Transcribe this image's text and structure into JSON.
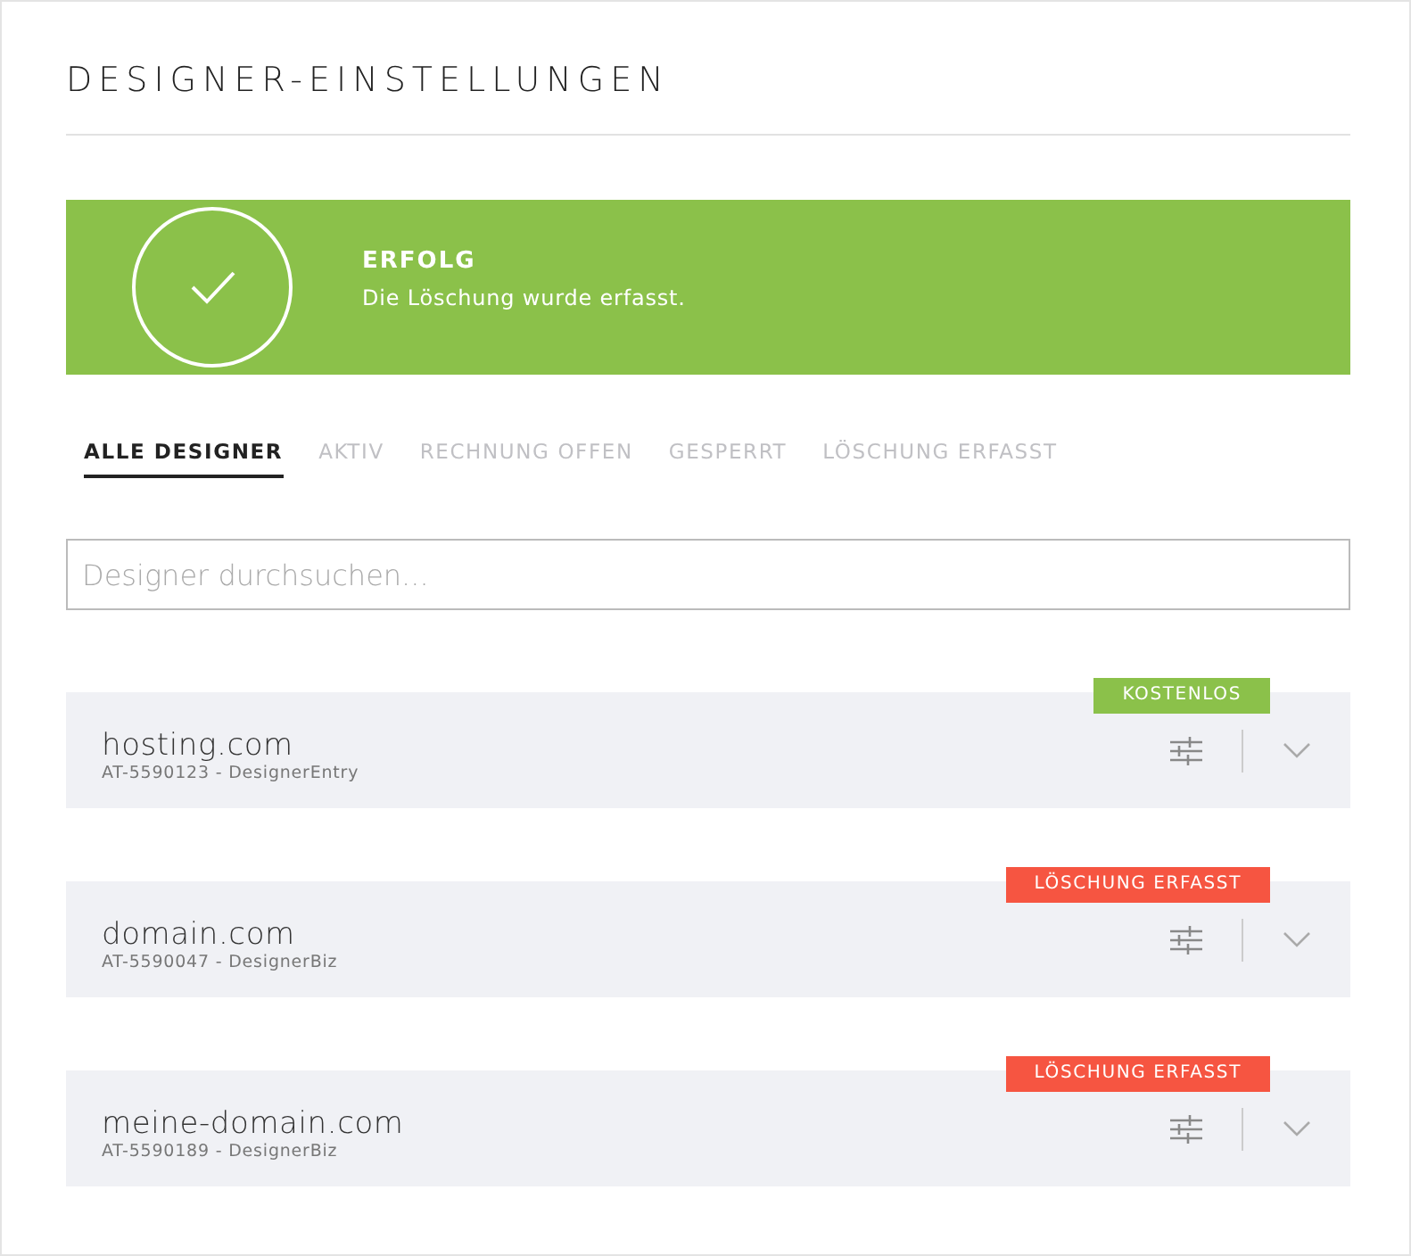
{
  "title": "DESIGNER-EINSTELLUNGEN",
  "alert": {
    "kind": "success",
    "heading": "ERFOLG",
    "message": "Die Löschung wurde erfasst."
  },
  "tabs": [
    {
      "label": "ALLE DESIGNER",
      "selected": true
    },
    {
      "label": "AKTIV",
      "selected": false
    },
    {
      "label": "RECHNUNG OFFEN",
      "selected": false
    },
    {
      "label": "GESPERRT",
      "selected": false
    },
    {
      "label": "LÖSCHUNG ERFASST",
      "selected": false
    }
  ],
  "search": {
    "placeholder": "Designer durchsuchen..."
  },
  "designers": [
    {
      "domain": "hosting.com",
      "details": "AT-5590123 - DesignerEntry",
      "badge": "KOSTENLOS",
      "color": "#8bc14a"
    },
    {
      "domain": "domain.com",
      "details": "AT-5590047 - DesignerBiz",
      "badge": "LÖSCHUNG ERFASST",
      "color": "#f65541"
    },
    {
      "domain": "meine-domain.com",
      "details": "AT-5590189 - DesignerBiz",
      "badge": "LÖSCHUNG ERFASST",
      "color": "#f65541"
    }
  ]
}
